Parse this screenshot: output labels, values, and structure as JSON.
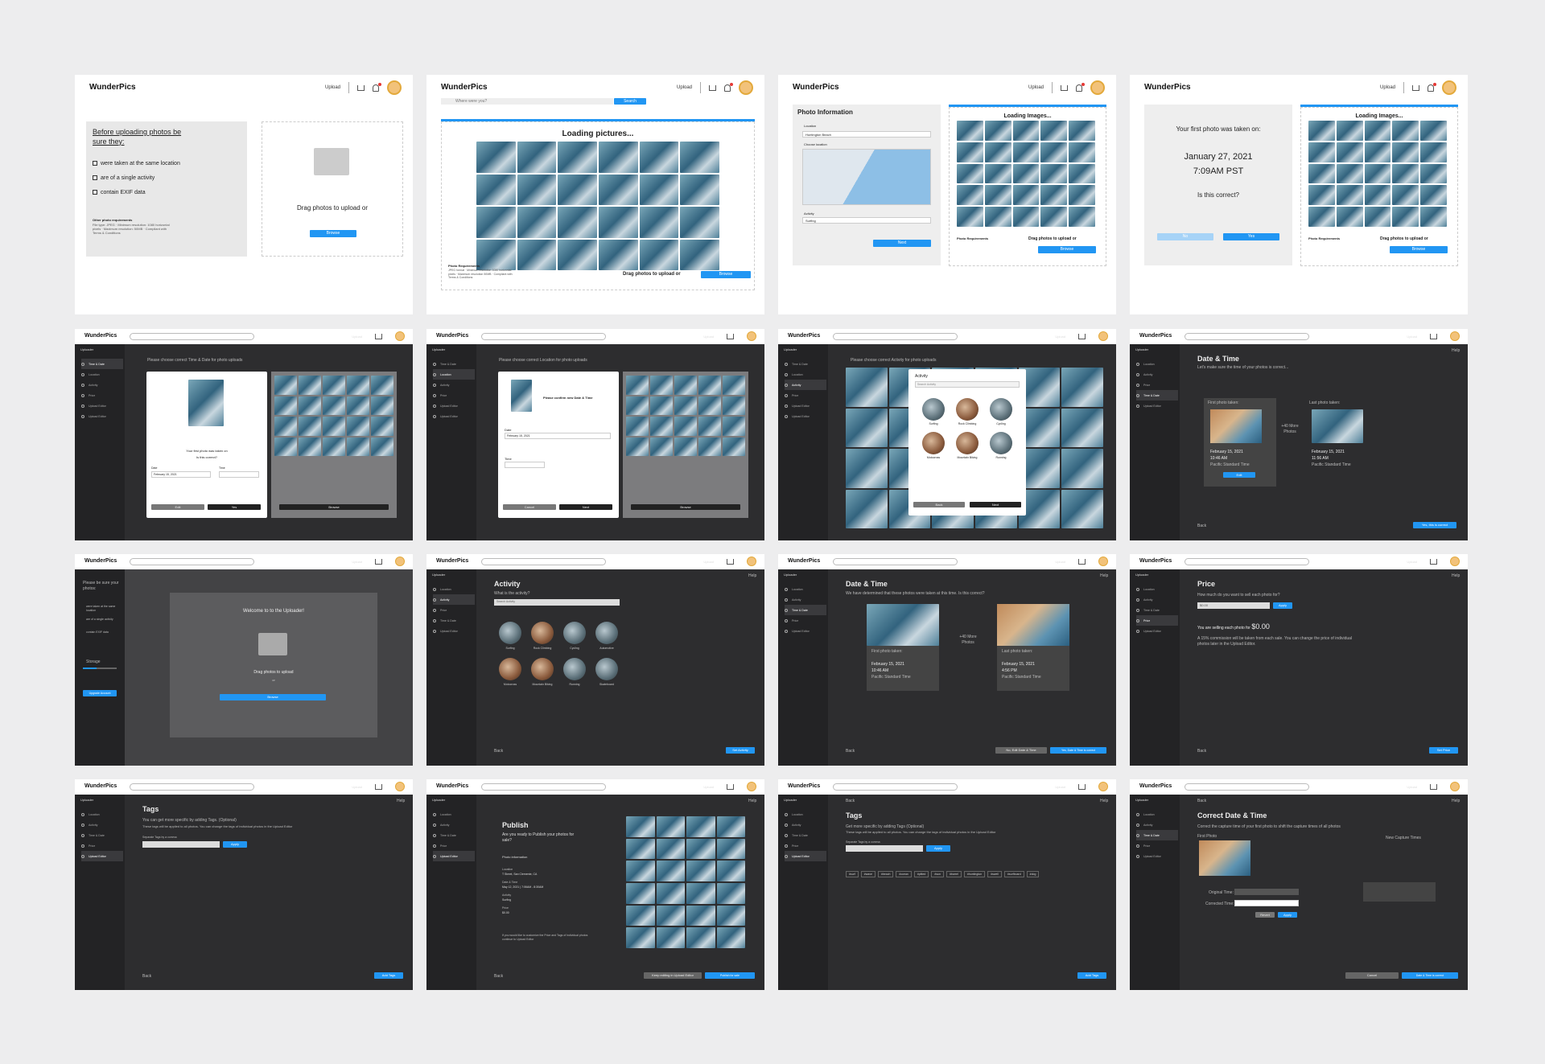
{
  "app": {
    "name": "WunderPics",
    "upload": "Upload",
    "browse": "Browse",
    "drag": "Drag photos to upload or",
    "search_placeholder": "Where were you?",
    "search_btn": "Search"
  },
  "s1": {
    "title": "Before uploading photos be sure they:",
    "items": [
      "were taken at the same location",
      "are of a single activity",
      "contain EXIF data"
    ],
    "reqs_title": "Other photo requirements",
    "reqs": "File type: JPEG · Minimum resolution: 1080 horizontal pixels · Maximum resolution: 50MB · Compliant with Terms & Conditions"
  },
  "s2": {
    "loading": "Loading pictures...",
    "reqs_title": "Photo Requirements",
    "reqs": "JPEG format · Minimum resolution 1080 horizontal pixels · Maximum resolution 50MB · Compliant with Terms & Conditions"
  },
  "s3": {
    "title": "Photo Information",
    "location_label": "Location",
    "location_value": "Huntington Beach",
    "choose": "Choose location",
    "activity_label": "Activity",
    "activity_value": "Surfing",
    "next": "Next",
    "loading": "Loading Images...",
    "reqs_title": "Photo Requirements"
  },
  "s4": {
    "first": "Your first photo was taken on:",
    "date": "January 27, 2021",
    "time": "7:09AM PST",
    "question": "Is this correct?",
    "no": "No",
    "yes": "Yes"
  },
  "dark": {
    "uploader": "Uploader",
    "steps": [
      "Time & Date",
      "Location",
      "Activity",
      "Price",
      "Upload Editor",
      "Upload Editor"
    ],
    "help": "Help",
    "back": "Back"
  },
  "s5": {
    "prompt": "Please choose correct Time & Date for photo uploads",
    "first": "Your first photo was taken on",
    "correct": "Is this correct?",
    "date_label": "Date",
    "time_label": "Time",
    "date_value": "February 15, 2021",
    "edit": "Edit",
    "yes": "Yes"
  },
  "s6": {
    "prompt": "Please choose correct Location for photo uploads",
    "confirm": "Please confirm new Date & Time",
    "date_label": "Date",
    "time_label": "Time",
    "cancel": "Cancel",
    "next": "Next"
  },
  "s7": {
    "prompt": "Please choose correct Activity for photo uploads",
    "activity": "Activity",
    "search": "Search Activity",
    "acts": [
      "Surfing",
      "Rock Climbing",
      "Cycling",
      "Motocross",
      "Mountain Biking",
      "Running"
    ],
    "back": "Back",
    "next": "Next"
  },
  "s8": {
    "title": "Date & Time",
    "sub": "Let's make sure the time of your photos is correct...",
    "first": "First photo taken:",
    "last": "Last photo taken:",
    "more": "+40 More Photos",
    "date1": "February 15, 2021",
    "time1": "10:46 AM",
    "zone": "Pacific Standard Time",
    "date2": "February 15, 2021",
    "time2": "11:56 AM",
    "edit": "Edit",
    "confirm": "Yes, this is correct"
  },
  "s9": {
    "side_title": "Please be sure your photos:",
    "welcome": "Welcome to to the Uploader!",
    "drag": "Drag photos to upload",
    "or": "or",
    "storage": "Storage",
    "upgrade": "Upgrade Account"
  },
  "s10": {
    "title": "Activity",
    "question": "What is the activity?",
    "search": "Search Activity",
    "acts": [
      "Surfing",
      "Rock Climbing",
      "Cycling",
      "Automotive",
      "Motocross",
      "Mountain Biking",
      "Running",
      "Skateboard"
    ],
    "set": "Set Activity"
  },
  "s11": {
    "title": "Date & Time",
    "sub": "We have determined that these photos were taken at this time. Is this correct?",
    "first": "First photo taken:",
    "last": "Last photo taken:",
    "more": "+40 More Photos",
    "date1": "February 15, 2021",
    "time1": "10:46 AM",
    "zone": "Pacific Standard Time",
    "date2": "February 15, 2021",
    "time2": "4:56 PM",
    "edit": "No, Edit Date & Time",
    "confirm": "Yes, Date & Time is correct"
  },
  "s12": {
    "title": "Price",
    "sub": "How much do you want to sell each photo for?",
    "price_in": "$0.00",
    "apply": "Apply",
    "selling": "You are selling each photo for",
    "amount": "$0.00",
    "note": "A 15% commission will be taken from each sale. You can change the price of individual photos later in the Upload Editor.",
    "set": "Set Price"
  },
  "s13": {
    "title": "Tags",
    "sub": "You can get more specific by adding Tags. (Optional)",
    "sub2": "These tags will be applied to all photos. You can change the tags of individual photos in the Upload Editor",
    "sep": "Separate Tags by a comma",
    "apply": "Apply",
    "add": "Add Tags"
  },
  "s14": {
    "title": "Publish",
    "question": "Are you ready to Publish your photos for sale?",
    "info": "Photo information",
    "loc_l": "Location",
    "loc_v": "T Street, San Clemente, CA",
    "dt_l": "Date & Time",
    "dt_v": "May 12, 2021 | 7:06AM - 8:30AM",
    "act_l": "Activity",
    "act_v": "Surfing",
    "price_l": "Price",
    "price_v": "$0.00",
    "note": "If you would like to customize the Price and Tags of individual photos continue to Upload Editor",
    "keep": "Keep editing in Upload Editor",
    "publish": "Publish for sale"
  },
  "s15": {
    "title": "Tags",
    "sub": "Get more specific by adding Tags (Optional)",
    "sub2": "These tags will be applied to all photos. You can change the tags of individual photos in the Upload Editor",
    "sep": "Separate Tags by a comma",
    "apply": "Apply",
    "tags": [
      "#surf",
      "#wave",
      "#beach",
      "#ocean",
      "#pitted",
      "#sun",
      "#barrel",
      "#huntington",
      "#swell",
      "#surfboard",
      "#dog"
    ],
    "add": "Add Tags"
  },
  "s16": {
    "title": "Correct Date & Time",
    "sub": "Correct the capture time of your first photo to shift the capture times of all photos",
    "first": "First Photo",
    "new": "New Capture Times",
    "orig": "Original Time:",
    "corrected": "Corrected Time:",
    "revert": "Revert",
    "apply": "Apply",
    "cancel": "Cancel",
    "save": "Date & Time is correct"
  }
}
